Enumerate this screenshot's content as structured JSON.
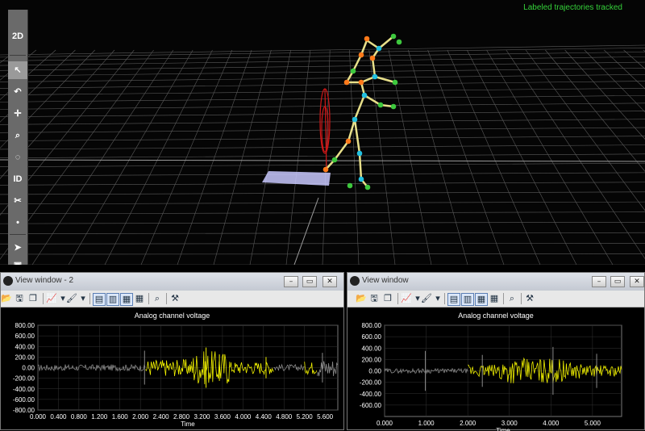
{
  "viewport": {
    "status_text": "Labeled trajectories tracked",
    "toolbar": {
      "items": [
        {
          "label": "2D",
          "icon": "2d-view-icon"
        },
        {
          "label": "",
          "icon": "select-arrow-icon"
        },
        {
          "label": "",
          "icon": "rotate-icon"
        },
        {
          "label": "",
          "icon": "translate-icon"
        },
        {
          "label": "",
          "icon": "zoom-icon"
        },
        {
          "label": "",
          "icon": "center-icon"
        },
        {
          "label": "ID",
          "icon": "identify-icon"
        },
        {
          "label": "",
          "icon": "cut-icon"
        },
        {
          "label": "",
          "icon": "join-icon"
        },
        {
          "label": "",
          "icon": "pointer-tool-icon"
        },
        {
          "label": "",
          "icon": "cube-icon"
        }
      ]
    }
  },
  "windows": [
    {
      "title": "View window - 2",
      "plot": {
        "title": "Analog channel voltage",
        "x_label": "Time",
        "y_ticks": [
          "800.00",
          "600.00",
          "400.00",
          "200.00",
          "0.00",
          "-200.00",
          "-400.00",
          "-600.00",
          "-800.00"
        ],
        "x_ticks": [
          "0.000",
          "0.400",
          "0.800",
          "1.200",
          "1.600",
          "2.000",
          "2.400",
          "2.800",
          "3.200",
          "3.600",
          "4.000",
          "4.400",
          "4.800",
          "5.200",
          "5.600"
        ]
      }
    },
    {
      "title": "View window",
      "plot": {
        "title": "Analog channel voltage",
        "x_label": "Time",
        "y_ticks": [
          "800.00",
          "600.00",
          "400.00",
          "200.00",
          "0.00",
          "-200.00",
          "-400.00",
          "-600.00"
        ],
        "x_ticks": [
          "0.000",
          "1.000",
          "2.000",
          "3.000",
          "4.000",
          "5.000"
        ]
      }
    }
  ],
  "colors": {
    "trace_inactive": "#8a8a8a",
    "trace_active": "#f0f000",
    "status_green": "#35d23a",
    "skeleton": "#e8e08a"
  }
}
